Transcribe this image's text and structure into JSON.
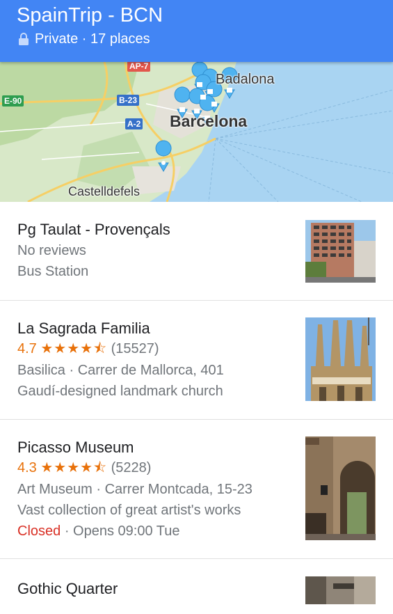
{
  "header": {
    "title": "SpainTrip - BCN",
    "subtitle": "Private · 17 places",
    "color": "#4285f4"
  },
  "map": {
    "labels": {
      "badalona": "Badalona",
      "barcelona": "Barcelona",
      "castelldefels": "Castelldefels"
    },
    "roads": {
      "ap7": "AP-7",
      "e90": "E-90",
      "b23": "B-23",
      "a2": "A-2"
    }
  },
  "places": [
    {
      "name": "Pg Taulat - Provençals",
      "reviews": "No reviews",
      "category": "Bus Station"
    },
    {
      "name": "La Sagrada Familia",
      "rating": "4.7",
      "stars": "★★★★⯪",
      "count": "(15527)",
      "details": "Basilica · Carrer de Mallorca, 401",
      "description": "Gaudí-designed landmark church"
    },
    {
      "name": "Picasso Museum",
      "rating": "4.3",
      "stars": "★★★★⯪",
      "count": "(5228)",
      "details": "Art Museum · Carrer Montcada, 15-23",
      "description": "Vast collection of great artist's works",
      "status": "Closed",
      "hours": " · Opens 09:00 Tue"
    },
    {
      "name": "Gothic Quarter"
    }
  ]
}
